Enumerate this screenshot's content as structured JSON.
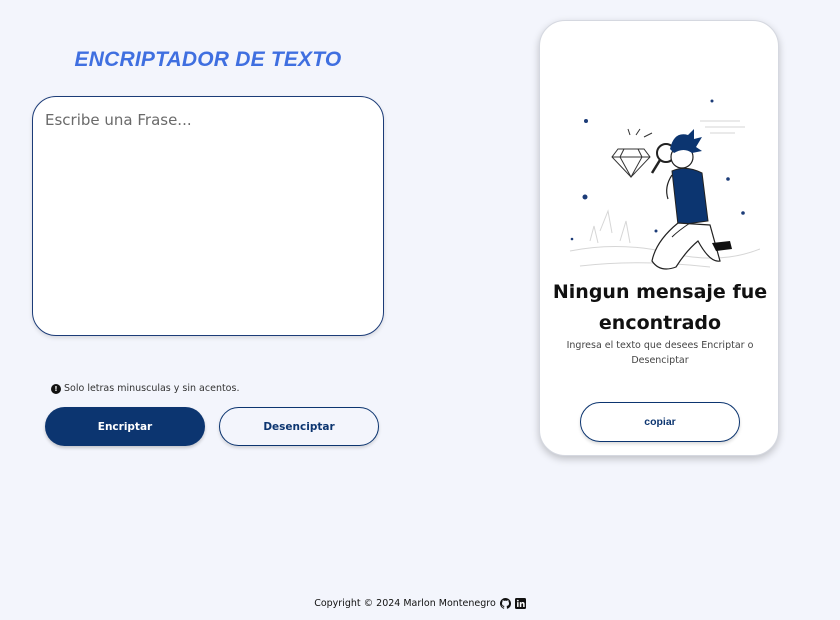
{
  "app": {
    "title": "ENCRIPTADOR DE TEXTO"
  },
  "input": {
    "placeholder": "Escribe una Frase...",
    "value": ""
  },
  "hint": {
    "icon": "exclamation-circle-icon",
    "text": "Solo letras minusculas y sin acentos."
  },
  "actions": {
    "encrypt_label": "Encriptar",
    "decrypt_label": "Desenciptar"
  },
  "output": {
    "illustration": "person-magnifying-glass-diamond-illustration",
    "heading": "Ningun mensaje fue encontrado",
    "subtext": "Ingresa el texto que desees Encriptar o Desenciptar",
    "copy_label": "copiar"
  },
  "footer": {
    "text": "Copyright © 2024 Marlon Montenegro",
    "icons": [
      "github-icon",
      "linkedin-icon"
    ]
  },
  "colors": {
    "background": "#f3f5fc",
    "title_accent": "#3f6fe0",
    "primary": "#0c3570"
  }
}
